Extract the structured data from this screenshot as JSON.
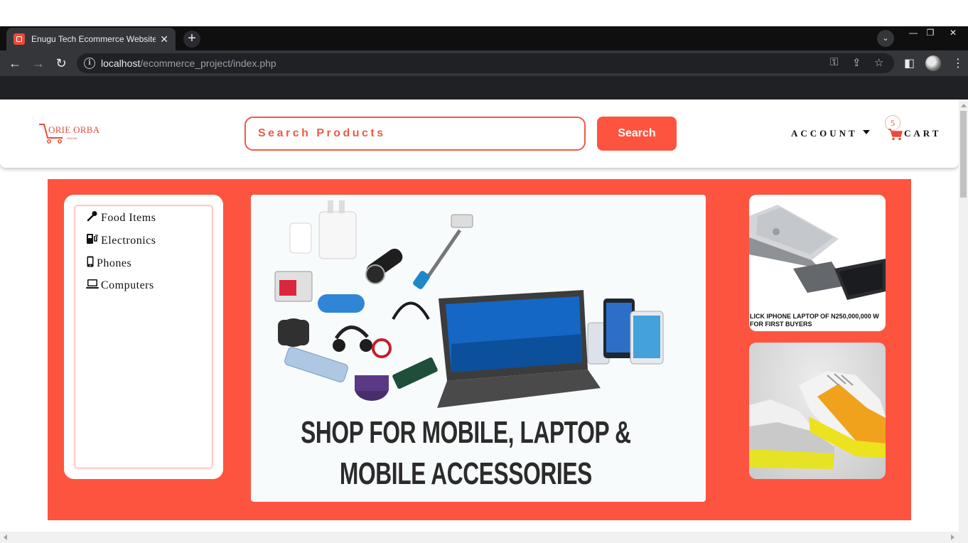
{
  "browser": {
    "tab_title": "Enugu Tech Ecommerce Website",
    "tab_close": "✕",
    "new_tab": "+",
    "url_host": "localhost",
    "url_path": "/ecommerce_project/index.php",
    "icons": [
      "back-icon",
      "forward-icon",
      "reload-icon",
      "info-icon",
      "key-icon",
      "share-icon",
      "star-icon",
      "sidepanel-icon",
      "profile-avatar",
      "menu-icon"
    ]
  },
  "header": {
    "logo_text": "ORIE ORBA",
    "logo_tagline": "ONLINE",
    "search_placeholder": "Search Products",
    "search_button": "Search",
    "account_label": "ACCOUNT",
    "cart_count": "5",
    "cart_label": "CART"
  },
  "categories": [
    {
      "label": "Food Items",
      "icon": "microphone-icon"
    },
    {
      "label": "Electronics",
      "icon": "charging-station-icon"
    },
    {
      "label": "Phones",
      "icon": "mobile-phone-icon"
    },
    {
      "label": "Computers",
      "icon": "laptop-icon"
    }
  ],
  "banner": {
    "line1": "SHOP FOR MOBILE, LAPTOP &",
    "line2": "MOBILE ACCESSORIES"
  },
  "promo": {
    "caption_line1": "LICK IPHONE LAPTOP OF N250,000,000 W",
    "caption_line2": "FOR FIRST BUYERS"
  },
  "colors": {
    "accent": "#fd5440",
    "browser_dark": "#35363a"
  }
}
